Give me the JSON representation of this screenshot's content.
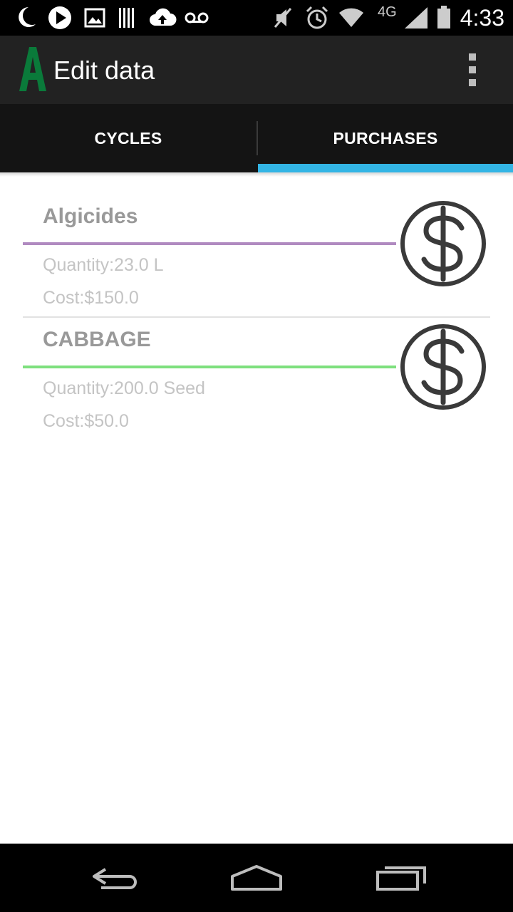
{
  "status_bar": {
    "time": "4:33",
    "network_label": "4G",
    "icons": [
      "moon-icon",
      "play-icon",
      "image-icon",
      "barcode-icon",
      "cloud-upload-icon",
      "voicemail-icon",
      "mute-icon",
      "alarm-icon",
      "wifi-icon",
      "signal-icon",
      "battery-icon"
    ]
  },
  "action_bar": {
    "title": "Edit data",
    "logo_letter": "A",
    "logo_color": "#0a7a3a",
    "overflow_icon": "more-vert-icon"
  },
  "tabs": [
    {
      "label": "CYCLES",
      "selected": false
    },
    {
      "label": "PURCHASES",
      "selected": true
    }
  ],
  "tab_indicator_color": "#33b5e5",
  "purchases": [
    {
      "name": "Algicides",
      "quantity": "Quantity:23.0 L",
      "cost": "Cost:$150.0",
      "accent_color": "#b08ac0",
      "icon": "dollar-icon"
    },
    {
      "name": "CABBAGE",
      "quantity": "Quantity:200.0 Seed",
      "cost": "Cost:$50.0",
      "accent_color": "#7ee07e",
      "icon": "dollar-icon"
    }
  ],
  "nav_bar": {
    "buttons": [
      "back-icon",
      "home-icon",
      "recents-icon"
    ]
  }
}
